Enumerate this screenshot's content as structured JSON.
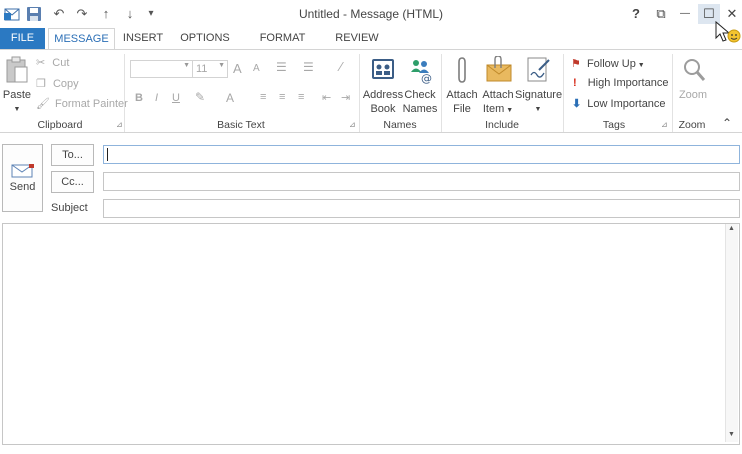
{
  "window": {
    "title": "Untitled - Message (HTML)",
    "help_glyph": "?",
    "restore_glyph": "⧉",
    "minimize_glyph": "—",
    "maximize_glyph": "☐",
    "close_glyph": "✕"
  },
  "quick_access": {
    "undo_glyph": "↶",
    "redo_glyph": "↷",
    "up_glyph": "↑",
    "down_glyph": "↓",
    "more_glyph": "▾"
  },
  "tabs": [
    {
      "label": "FILE"
    },
    {
      "label": "MESSAGE"
    },
    {
      "label": "INSERT"
    },
    {
      "label": "OPTIONS"
    },
    {
      "label": "FORMAT TEXT"
    },
    {
      "label": "REVIEW"
    }
  ],
  "ribbon": {
    "clipboard": {
      "label": "Clipboard",
      "paste": "Paste",
      "cut": "Cut",
      "copy": "Copy",
      "format_painter": "Format Painter"
    },
    "basic_text": {
      "label": "Basic Text",
      "font_name": "",
      "font_size": "11",
      "grow_font": "A",
      "shrink_font": "A",
      "bold": "B",
      "italic": "I",
      "underline": "U",
      "font_color": "A"
    },
    "names": {
      "label": "Names",
      "address_book_1": "Address",
      "address_book_2": "Book",
      "check_names_1": "Check",
      "check_names_2": "Names"
    },
    "include": {
      "label": "Include",
      "attach_file_1": "Attach",
      "attach_file_2": "File",
      "attach_item_1": "Attach",
      "attach_item_2": "Item",
      "signature": "Signature"
    },
    "tags": {
      "label": "Tags",
      "follow_up": "Follow Up",
      "high_importance": "High Importance",
      "low_importance": "Low Importance"
    },
    "zoom": {
      "label": "Zoom",
      "zoom": "Zoom"
    },
    "collapse_glyph": "⌃"
  },
  "compose": {
    "send": "Send",
    "to": "To...",
    "cc": "Cc...",
    "subject": "Subject",
    "to_value": "",
    "cc_value": "",
    "subject_value": ""
  },
  "colors": {
    "file_tab": "#2b79c2",
    "accent": "#2b6fb6",
    "follow_up_flag": "#c0392b",
    "high_importance": "#d62c1a",
    "low_importance": "#2b6fb6"
  }
}
